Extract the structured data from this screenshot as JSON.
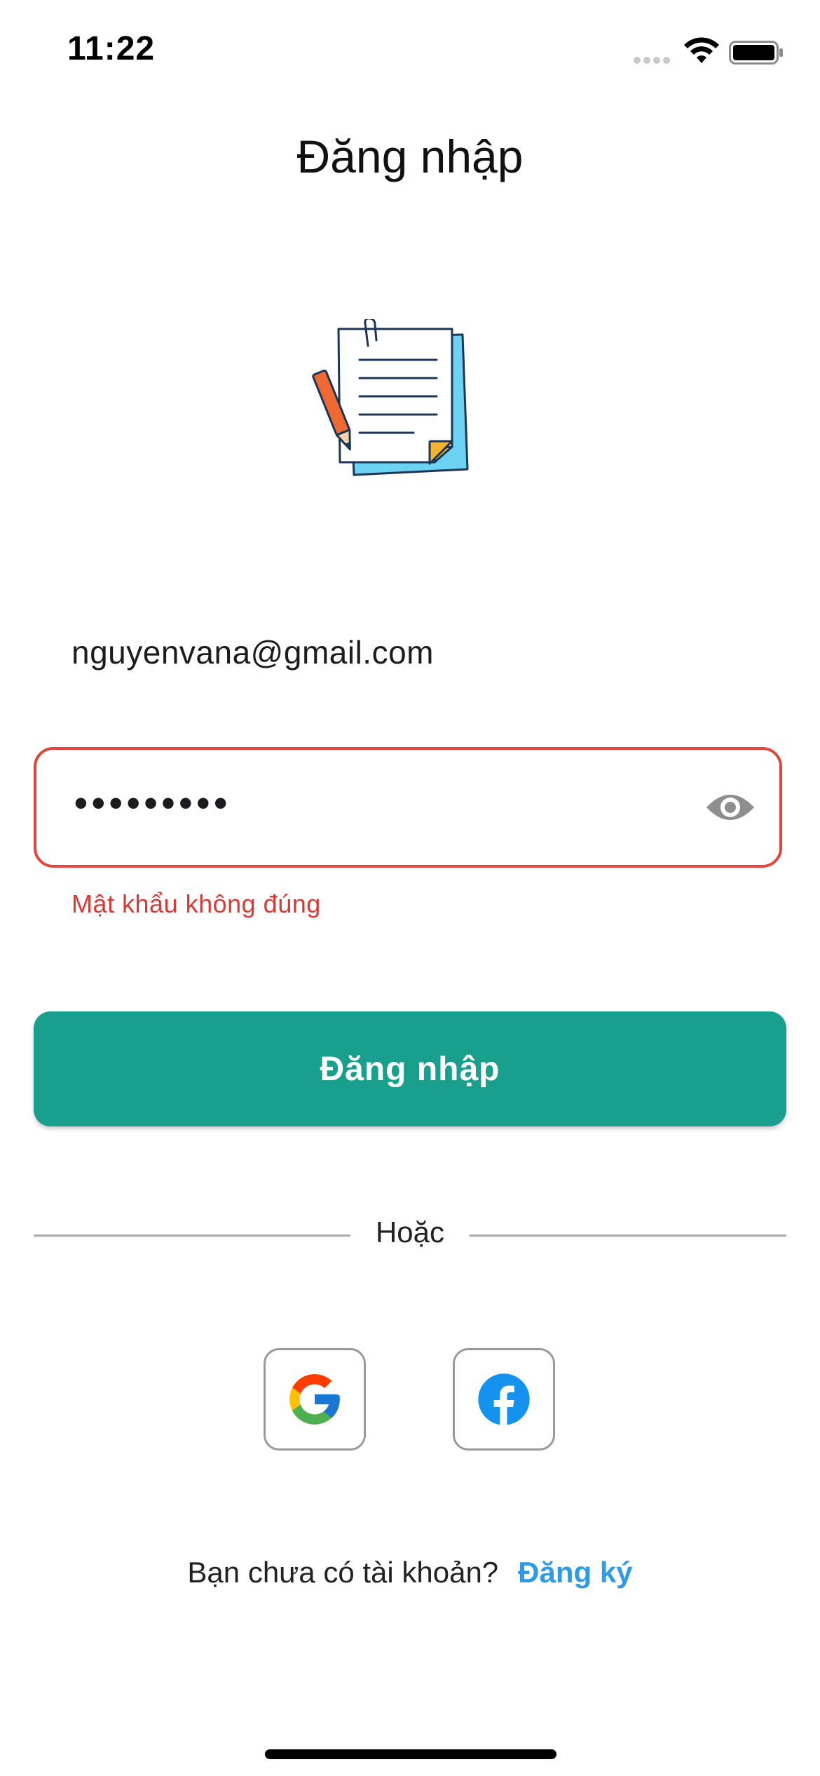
{
  "status_bar": {
    "time": "11:22"
  },
  "header": {
    "title": "Đăng nhập"
  },
  "form": {
    "email_value": "nguyenvana@gmail.com",
    "password_value": "•••••••••",
    "password_error": "Mật khẩu không đúng",
    "login_button_label": "Đăng nhập"
  },
  "divider": {
    "label": "Hoặc"
  },
  "social": {
    "google_icon": "google-logo",
    "facebook_icon": "facebook-logo"
  },
  "footer": {
    "prompt": "Bạn chưa có tài khoản?",
    "register_link": "Đăng ký"
  },
  "colors": {
    "primary": "#18a08c",
    "error": "#e0463e",
    "link": "#2e9be8"
  }
}
